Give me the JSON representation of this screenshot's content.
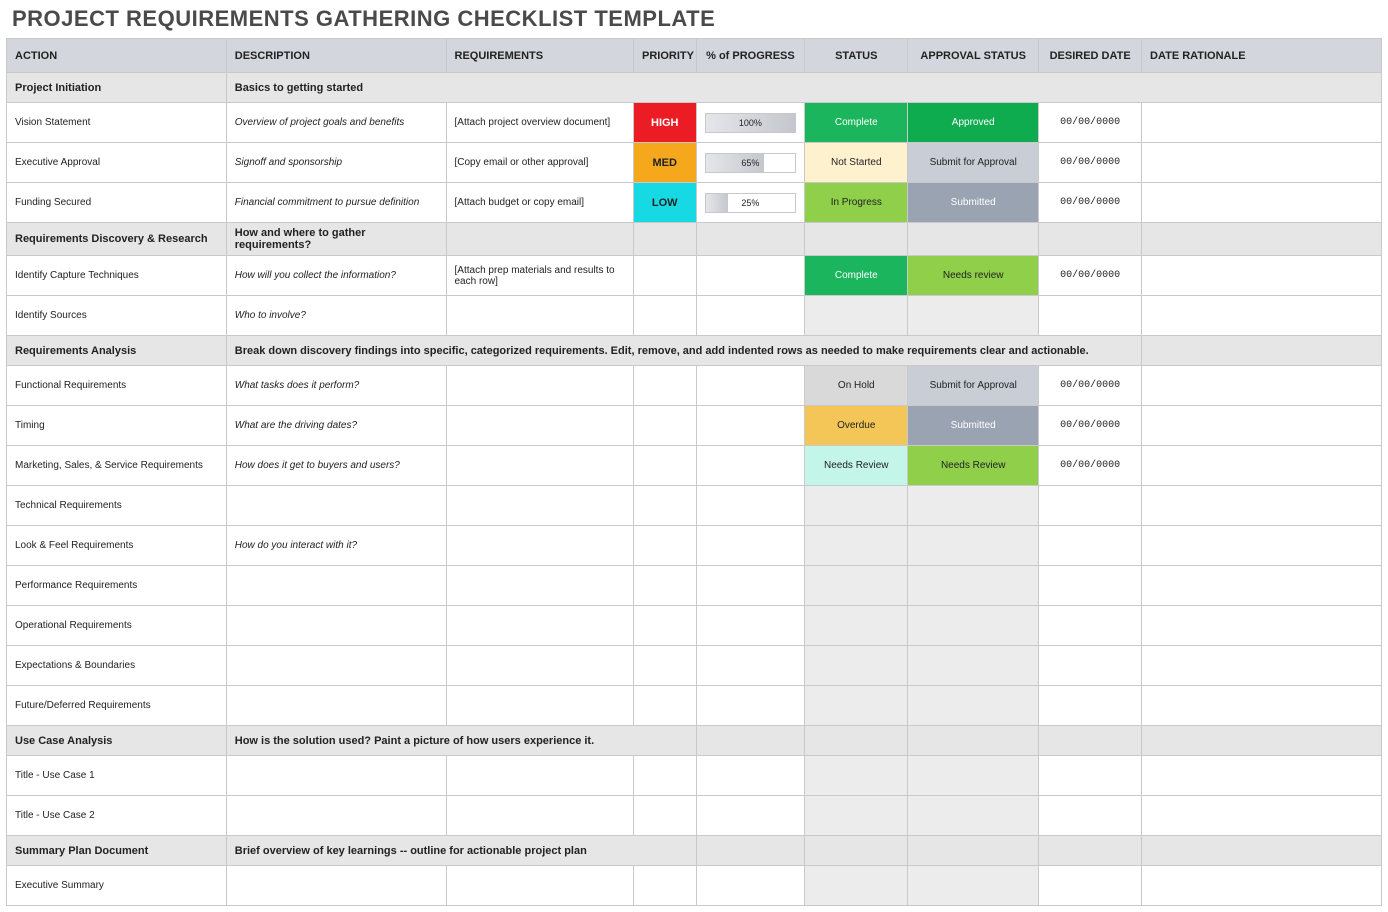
{
  "title": "PROJECT REQUIREMENTS GATHERING CHECKLIST TEMPLATE",
  "headers": {
    "action": "ACTION",
    "description": "DESCRIPTION",
    "requirements": "REQUIREMENTS",
    "priority": "PRIORITY",
    "progress": "% of PROGRESS",
    "status": "STATUS",
    "approval": "APPROVAL STATUS",
    "date": "DESIRED DATE",
    "rationale": "DATE RATIONALE"
  },
  "sections": {
    "s1": {
      "action": "Project Initiation",
      "desc": "Basics to getting started"
    },
    "s2": {
      "action": "Requirements Discovery & Research",
      "desc": "How and where to gather requirements?"
    },
    "s3": {
      "action": "Requirements Analysis",
      "desc": "Break down discovery findings into specific, categorized requirements. Edit, remove, and add indented rows as needed to make requirements clear and actionable."
    },
    "s4": {
      "action": "Use Case Analysis",
      "desc": "How is the solution used? Paint a picture of how users experience it."
    },
    "s5": {
      "action": "Summary Plan Document",
      "desc": "Brief overview of key learnings -- outline for actionable project plan"
    }
  },
  "rows": {
    "r1": {
      "action": "Vision Statement",
      "desc": "Overview of project goals and benefits",
      "req": "[Attach project overview document]",
      "pri": "HIGH",
      "prog": "100%",
      "status": "Complete",
      "approval": "Approved",
      "date": "00/00/0000"
    },
    "r2": {
      "action": "Executive Approval",
      "desc": "Signoff and sponsorship",
      "req": "[Copy email or other approval]",
      "pri": "MED",
      "prog": "65%",
      "status": "Not Started",
      "approval": "Submit for Approval",
      "date": "00/00/0000"
    },
    "r3": {
      "action": "Funding Secured",
      "desc": "Financial commitment to pursue definition",
      "req": "[Attach budget or copy email]",
      "pri": "LOW",
      "prog": "25%",
      "status": "In Progress",
      "approval": "Submitted",
      "date": "00/00/0000"
    },
    "r4": {
      "action": "Identify Capture Techniques",
      "desc": "How will you collect the information?",
      "req": "[Attach prep materials and results to each row]",
      "status": "Complete",
      "approval": "Needs review",
      "date": "00/00/0000"
    },
    "r5": {
      "action": "Identify Sources",
      "desc": "Who to involve?"
    },
    "r6": {
      "action": "Functional Requirements",
      "desc": "What tasks does it perform?",
      "status": "On Hold",
      "approval": "Submit for Approval",
      "date": "00/00/0000"
    },
    "r7": {
      "action": "Timing",
      "desc": "What are the driving dates?",
      "status": "Overdue",
      "approval": "Submitted",
      "date": "00/00/0000"
    },
    "r8": {
      "action": "Marketing, Sales, & Service Requirements",
      "desc": "How does it get to buyers and users?",
      "status": "Needs Review",
      "approval": "Needs Review",
      "date": "00/00/0000"
    },
    "r9": {
      "action": "Technical Requirements"
    },
    "r10": {
      "action": "Look & Feel Requirements",
      "desc": "How do you interact with it?"
    },
    "r11": {
      "action": "Performance Requirements"
    },
    "r12": {
      "action": "Operational Requirements"
    },
    "r13": {
      "action": "Expectations & Boundaries"
    },
    "r14": {
      "action": "Future/Deferred Requirements"
    },
    "r15": {
      "action": "Title - Use Case 1"
    },
    "r16": {
      "action": "Title - Use Case 2"
    },
    "r17": {
      "action": "Executive Summary"
    }
  }
}
